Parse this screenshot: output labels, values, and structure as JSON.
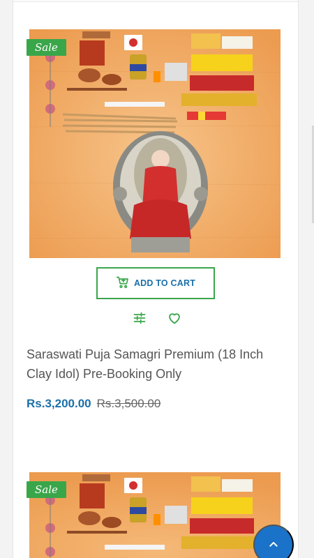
{
  "products": [
    {
      "badge": "Sale",
      "image_alt": "Saraswati Puja Samagri items with idol",
      "add_to_cart_label": "ADD TO CART",
      "title": "Saraswati Puja Samagri Premium (18 Inch Clay Idol) Pre-Booking Only",
      "price_sale": "Rs.3,200.00",
      "price_regular": "Rs.3,500.00"
    },
    {
      "badge": "Sale",
      "image_alt": "Saraswati Puja Samagri items"
    }
  ],
  "icons": {
    "cart": "add-to-cart-icon",
    "compare": "compare-icon",
    "wishlist": "heart-icon",
    "back_to_top": "chevron-up-icon"
  },
  "colors": {
    "accent_green": "#3aa64a",
    "price_blue": "#1b6fa8",
    "fab_blue": "#1a73c8",
    "image_bg": "#f0a35e"
  }
}
